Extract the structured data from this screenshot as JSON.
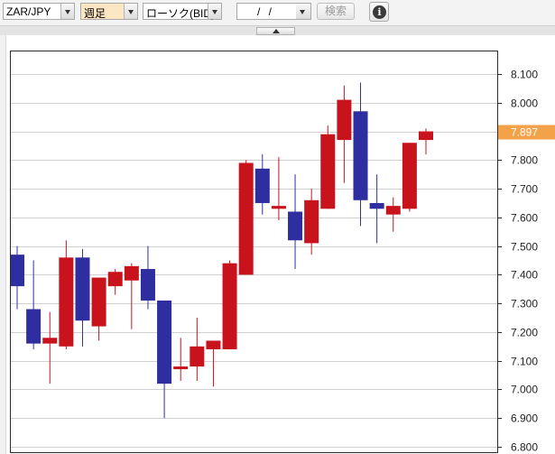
{
  "toolbar": {
    "pair": "ZAR/JPY",
    "period": "週足",
    "chart_type": "ローソク(BID)",
    "date": "/ /",
    "search_label": "検索",
    "info_glyph": "i"
  },
  "icons": {
    "info": "info-icon",
    "dropdown": "chevron-down-icon",
    "collapse": "chevron-up-icon"
  },
  "colors": {
    "up": "#c8131d",
    "down": "#2e2ea0",
    "current_price_bg": "#f4a24a"
  },
  "chart_data": {
    "type": "candlestick",
    "ylim": [
      6.8,
      8.15
    ],
    "yticks": [
      6.8,
      6.9,
      7.0,
      7.1,
      7.2,
      7.3,
      7.4,
      7.5,
      7.6,
      7.7,
      7.8,
      7.9,
      8.0,
      8.1
    ],
    "ytick_labels": [
      "6.800",
      "6.900",
      "7.000",
      "7.100",
      "7.200",
      "7.300",
      "7.400",
      "7.500",
      "7.600",
      "7.700",
      "7.800",
      "",
      "8.000",
      "8.100"
    ],
    "current_price": 7.897,
    "current_price_label": "7.897",
    "grid": true,
    "candles": [
      {
        "o": 7.47,
        "h": 7.5,
        "l": 7.28,
        "c": 7.36
      },
      {
        "o": 7.28,
        "h": 7.45,
        "l": 7.14,
        "c": 7.16
      },
      {
        "o": 7.16,
        "h": 7.27,
        "l": 7.02,
        "c": 7.18
      },
      {
        "o": 7.15,
        "h": 7.52,
        "l": 7.14,
        "c": 7.46
      },
      {
        "o": 7.46,
        "h": 7.49,
        "l": 7.15,
        "c": 7.24
      },
      {
        "o": 7.22,
        "h": 7.39,
        "l": 7.17,
        "c": 7.39
      },
      {
        "o": 7.36,
        "h": 7.42,
        "l": 7.33,
        "c": 7.41
      },
      {
        "o": 7.38,
        "h": 7.44,
        "l": 7.21,
        "c": 7.43
      },
      {
        "o": 7.42,
        "h": 7.5,
        "l": 7.28,
        "c": 7.31
      },
      {
        "o": 7.31,
        "h": 7.31,
        "l": 6.9,
        "c": 7.02
      },
      {
        "o": 7.08,
        "h": 7.18,
        "l": 7.03,
        "c": 7.08
      },
      {
        "o": 7.08,
        "h": 7.25,
        "l": 7.03,
        "c": 7.15
      },
      {
        "o": 7.14,
        "h": 7.16,
        "l": 7.01,
        "c": 7.17
      },
      {
        "o": 7.14,
        "h": 7.45,
        "l": 7.14,
        "c": 7.44
      },
      {
        "o": 7.4,
        "h": 7.8,
        "l": 7.4,
        "c": 7.79
      },
      {
        "o": 7.77,
        "h": 7.82,
        "l": 7.61,
        "c": 7.65
      },
      {
        "o": 7.63,
        "h": 7.81,
        "l": 7.59,
        "c": 7.64
      },
      {
        "o": 7.62,
        "h": 7.75,
        "l": 7.42,
        "c": 7.52
      },
      {
        "o": 7.51,
        "h": 7.7,
        "l": 7.47,
        "c": 7.66
      },
      {
        "o": 7.63,
        "h": 7.92,
        "l": 7.63,
        "c": 7.89
      },
      {
        "o": 7.87,
        "h": 8.06,
        "l": 7.72,
        "c": 8.01
      },
      {
        "o": 7.97,
        "h": 8.07,
        "l": 7.57,
        "c": 7.66
      },
      {
        "o": 7.65,
        "h": 7.75,
        "l": 7.51,
        "c": 7.63
      },
      {
        "o": 7.61,
        "h": 7.67,
        "l": 7.55,
        "c": 7.64
      },
      {
        "o": 7.63,
        "h": 7.86,
        "l": 7.62,
        "c": 7.86
      },
      {
        "o": 7.87,
        "h": 7.91,
        "l": 7.82,
        "c": 7.9
      }
    ]
  }
}
